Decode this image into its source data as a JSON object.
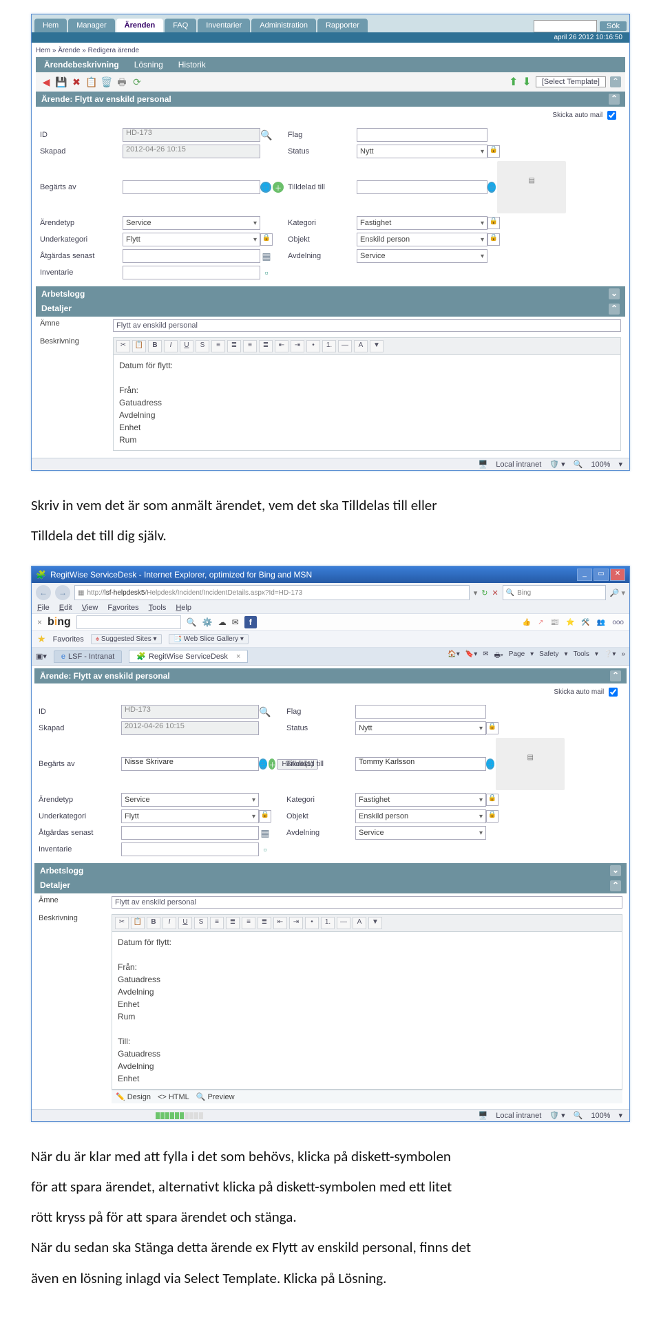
{
  "shot1": {
    "tabs": [
      "Hem",
      "Manager",
      "Ärenden",
      "FAQ",
      "Inventarier",
      "Administration",
      "Rapporter"
    ],
    "active_tab_index": 2,
    "search_btn": "Sök",
    "datebar": "april 26 2012 10:16:50",
    "breadcrumb": "Hem » Ärende » Redigera ärende",
    "subtabs": [
      "Ärendebeskrivning",
      "Lösning",
      "Historik"
    ],
    "template_label": "[Select Template]",
    "section_title": "Ärende: Flytt av enskild personal",
    "auto_mail": "Skicka auto mail",
    "fields": {
      "id_lbl": "ID",
      "id_val": "HD-173",
      "flag_lbl": "Flag",
      "skapad_lbl": "Skapad",
      "skapad_val": "2012-04-26 10:15",
      "status_lbl": "Status",
      "status_val": "Nytt",
      "begarts_lbl": "Begärts av",
      "tilldelad_lbl": "Tilldelad till",
      "atyp_lbl": "Ärendetyp",
      "atyp_val": "Service",
      "kat_lbl": "Kategori",
      "kat_val": "Fastighet",
      "ukat_lbl": "Underkategori",
      "ukat_val": "Flytt",
      "obj_lbl": "Objekt",
      "obj_val": "Enskild person",
      "atg_lbl": "Åtgärdas senast",
      "avd_lbl": "Avdelning",
      "avd_val": "Service",
      "inv_lbl": "Inventarie"
    },
    "arbetslogg": "Arbetslogg",
    "detaljer": "Detaljer",
    "amne_lbl": "Ämne",
    "amne_val": "Flytt av enskild personal",
    "beskr_lbl": "Beskrivning",
    "rtx_lines": [
      "Datum för flytt:",
      "",
      "Från:",
      "Gatuadress",
      "Avdelning",
      "Enhet",
      "Rum"
    ],
    "zone": "Local intranet",
    "zoom": "100%"
  },
  "para1a": "Skriv in vem det är som anmält ärendet, vem det ska Tilldelas till eller",
  "para1b": "Tilldela det till dig själv.",
  "shot2": {
    "ie_title": "RegitWise ServiceDesk - Internet Explorer, optimized for Bing and MSN",
    "addr_grey": "http://",
    "addr_black": "lsf-helpdesk5",
    "addr_rest": "/Helpdesk/Incident/IncidentDetails.aspx?Id=HD-173",
    "bing_name": "Bing",
    "menus": [
      "File",
      "Edit",
      "View",
      "Favorites",
      "Tools",
      "Help"
    ],
    "close_x": "×",
    "bing_logo": "bing",
    "fav_label": "Favorites",
    "sugg": "Suggested Sites",
    "wsg": "Web Slice Gallery",
    "ooo": "ooo",
    "tabs_row": {
      "a": "LSF - Intranat",
      "b": "RegitWise ServiceDesk",
      "x": "×"
    },
    "tools": [
      "Page",
      "Safety",
      "Tools"
    ],
    "section_title": "Ärende: Flytt av enskild personal",
    "auto_mail": "Skicka auto mail",
    "fields": {
      "id_lbl": "ID",
      "id_val": "HD-173",
      "flag_lbl": "Flag",
      "skapad_lbl": "Skapad",
      "skapad_val": "2012-04-26 10:15",
      "status_lbl": "Status",
      "status_val": "Nytt",
      "begarts_lbl": "Begärts av",
      "begarts_val": "Nisse Skrivare",
      "hist_btn": "Historik(1)",
      "tilldelad_lbl": "Tilldelad till",
      "tilldelad_val": "Tommy Karlsson",
      "atyp_lbl": "Ärendetyp",
      "atyp_val": "Service",
      "kat_lbl": "Kategori",
      "kat_val": "Fastighet",
      "ukat_lbl": "Underkategori",
      "ukat_val": "Flytt",
      "obj_lbl": "Objekt",
      "obj_val": "Enskild person",
      "atg_lbl": "Åtgärdas senast",
      "avd_lbl": "Avdelning",
      "avd_val": "Service",
      "inv_lbl": "Inventarie"
    },
    "arbetslogg": "Arbetslogg",
    "detaljer": "Detaljer",
    "amne_lbl": "Ämne",
    "amne_val": "Flytt av enskild personal",
    "beskr_lbl": "Beskrivning",
    "rtx_lines": [
      "Datum för flytt:",
      "",
      "Från:",
      "Gatuadress",
      "Avdelning",
      "Enhet",
      "Rum",
      "",
      "Till:",
      "Gatuadress",
      "Avdelning",
      "Enhet"
    ],
    "rtx_tabs": {
      "design": "Design",
      "html": "HTML",
      "preview": "Preview"
    },
    "zone": "Local intranet",
    "zoom": "100%"
  },
  "para2a": "När du är klar med att fylla i det som behövs, klicka på diskett-symbolen",
  "para2b": "för att spara ärendet, alternativt klicka på diskett-symbolen med ett litet",
  "para2c": "rött kryss på för att spara ärendet och stänga.",
  "para2d": "När du sedan ska Stänga detta ärende ex Flytt av enskild personal, finns det",
  "para2e": "även en lösning  inlagd via Select Template. Klicka på Lösning."
}
